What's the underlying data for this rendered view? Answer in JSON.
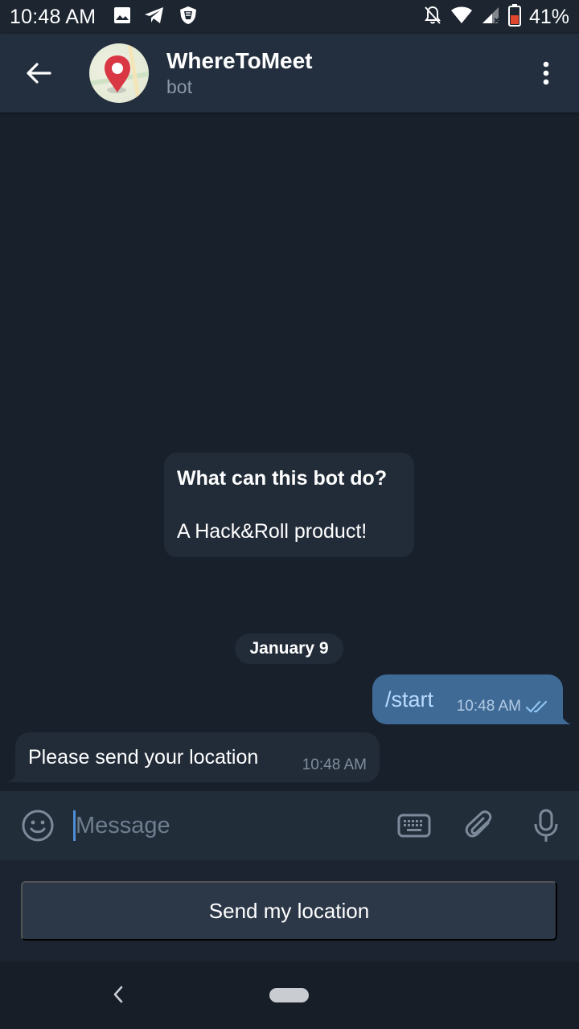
{
  "status_bar": {
    "time": "10:48 AM",
    "battery": "41%",
    "icons": [
      "gallery-icon",
      "telegram-icon",
      "shield-icon",
      "mute-icon",
      "wifi-icon",
      "signal-icon",
      "battery-icon"
    ]
  },
  "header": {
    "title": "WhereToMeet",
    "subtitle": "bot",
    "avatar_icon": "map-pin-icon"
  },
  "bot_info": {
    "title": "What can this bot do?",
    "description": "A Hack&Roll product!"
  },
  "date_label": "January 9",
  "messages": [
    {
      "direction": "out",
      "text": "/start",
      "time": "10:48 AM",
      "status": "read"
    },
    {
      "direction": "in",
      "text": "Please send your location",
      "time": "10:48 AM"
    }
  ],
  "input": {
    "placeholder": "Message",
    "value": ""
  },
  "keyboard": {
    "button_label": "Send my location"
  },
  "colors": {
    "background": "#18202b",
    "header": "#232f3e",
    "outgoing_bubble": "#3f6a96",
    "incoming_bubble": "#222c39",
    "accent": "#4f8ed6",
    "pin": "#d93744"
  }
}
